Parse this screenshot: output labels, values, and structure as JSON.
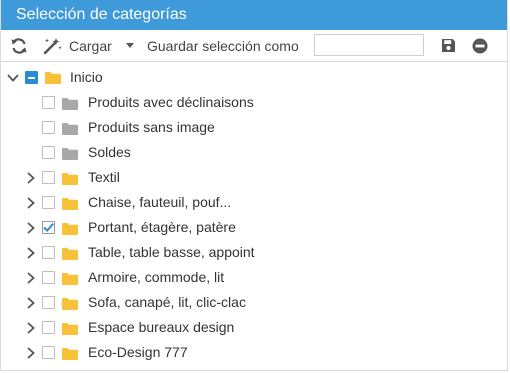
{
  "title": "Selección de categorías",
  "toolbar": {
    "load_label": "Cargar",
    "save_selection_label": "Guardar selección como",
    "name_input_value": "",
    "name_input_placeholder": ""
  },
  "colors": {
    "header": "#3f9ad9",
    "folder_yellow": "#f7c23a",
    "folder_gray": "#a8a8a8",
    "checkbox_blue": "#2a8bd5"
  },
  "tree": {
    "root": {
      "label": "Inicio",
      "expanded": true,
      "state": "partial",
      "folder": "yellow"
    },
    "items": [
      {
        "label": "Produits avec déclinaisons",
        "has_children": false,
        "checked": false,
        "folder": "gray"
      },
      {
        "label": "Produits sans image",
        "has_children": false,
        "checked": false,
        "folder": "gray"
      },
      {
        "label": "Soldes",
        "has_children": false,
        "checked": false,
        "folder": "gray"
      },
      {
        "label": "Textil",
        "has_children": true,
        "checked": false,
        "folder": "yellow"
      },
      {
        "label": "Chaise, fauteuil, pouf...",
        "has_children": true,
        "checked": false,
        "folder": "yellow"
      },
      {
        "label": "Portant, étagère, patère",
        "has_children": true,
        "checked": true,
        "folder": "yellow"
      },
      {
        "label": "Table, table basse, appoint",
        "has_children": true,
        "checked": false,
        "folder": "yellow"
      },
      {
        "label": "Armoire, commode, lit",
        "has_children": true,
        "checked": false,
        "folder": "yellow"
      },
      {
        "label": "Sofa, canapé, lit, clic-clac",
        "has_children": true,
        "checked": false,
        "folder": "yellow"
      },
      {
        "label": "Espace bureaux design",
        "has_children": true,
        "checked": false,
        "folder": "yellow"
      },
      {
        "label": "Eco-Design 777",
        "has_children": true,
        "checked": false,
        "folder": "yellow"
      }
    ]
  }
}
